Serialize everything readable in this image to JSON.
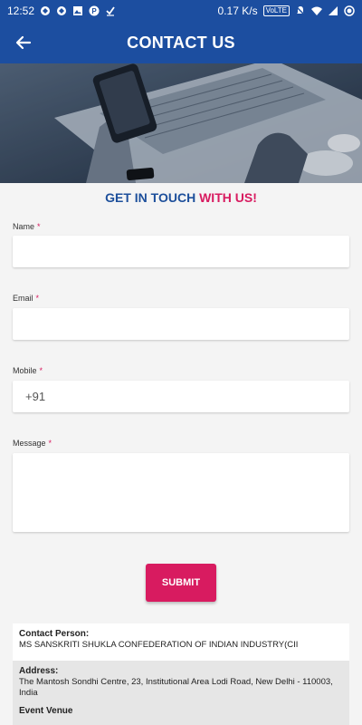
{
  "status_bar": {
    "time": "12:52",
    "speed": "0.17 K/s",
    "network": "VoLTE",
    "icons_left": [
      "signal-app-icon",
      "signal-app-icon",
      "image-icon",
      "p-icon",
      "check-icon"
    ],
    "icons_right": [
      "mute-icon",
      "wifi-icon",
      "cell-icon",
      "battery-icon"
    ]
  },
  "app_bar": {
    "title": "CONTACT US",
    "back_icon": "arrow-back-icon",
    "color": "#1c4ea0"
  },
  "heading": {
    "part1": "GET IN TOUCH",
    "part2": "WITH US!"
  },
  "form": {
    "name_label": "Name",
    "email_label": "Email",
    "mobile_label": "Mobile",
    "mobile_value": "+91",
    "message_label": "Message",
    "required_mark": "*",
    "submit_label": "SUBMIT",
    "accent_color": "#d81b60"
  },
  "contact": {
    "person_label": "Contact Person:",
    "person_value": "MS SANSKRITI SHUKLA CONFEDERATION OF INDIAN INDUSTRY(CII",
    "address_label": "Address:",
    "address_value": "The Mantosh Sondhi Centre, 23, Institutional Area Lodi Road, New Delhi - 110003, India",
    "venue_label": "Event Venue"
  }
}
